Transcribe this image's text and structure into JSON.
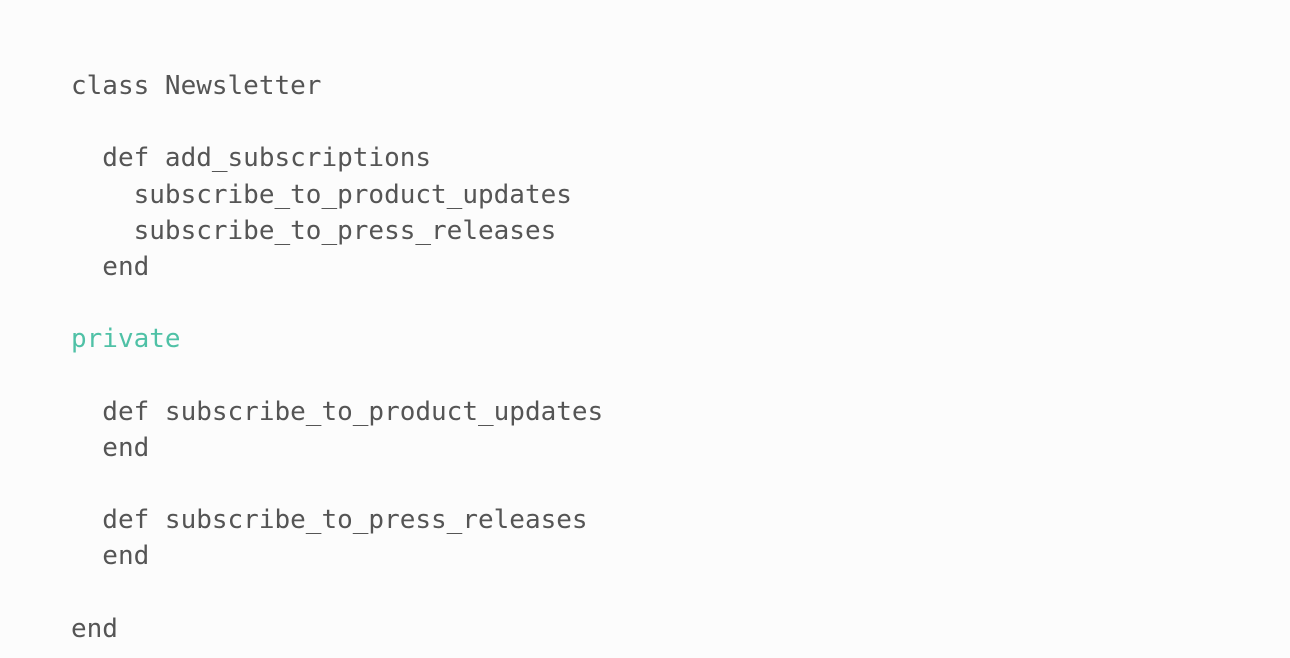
{
  "editor": {
    "accent_color": "#4fc1a6",
    "text_color": "#555555",
    "lines": [
      "class Newsletter",
      "",
      "  def add_subscriptions",
      "    subscribe_to_product_updates",
      "    subscribe_to_press_releases",
      "  end",
      "",
      "private",
      "",
      "  def subscribe_to_product_updates",
      "  end",
      "",
      "  def subscribe_to_press_releases",
      "  end",
      "",
      "end"
    ]
  }
}
